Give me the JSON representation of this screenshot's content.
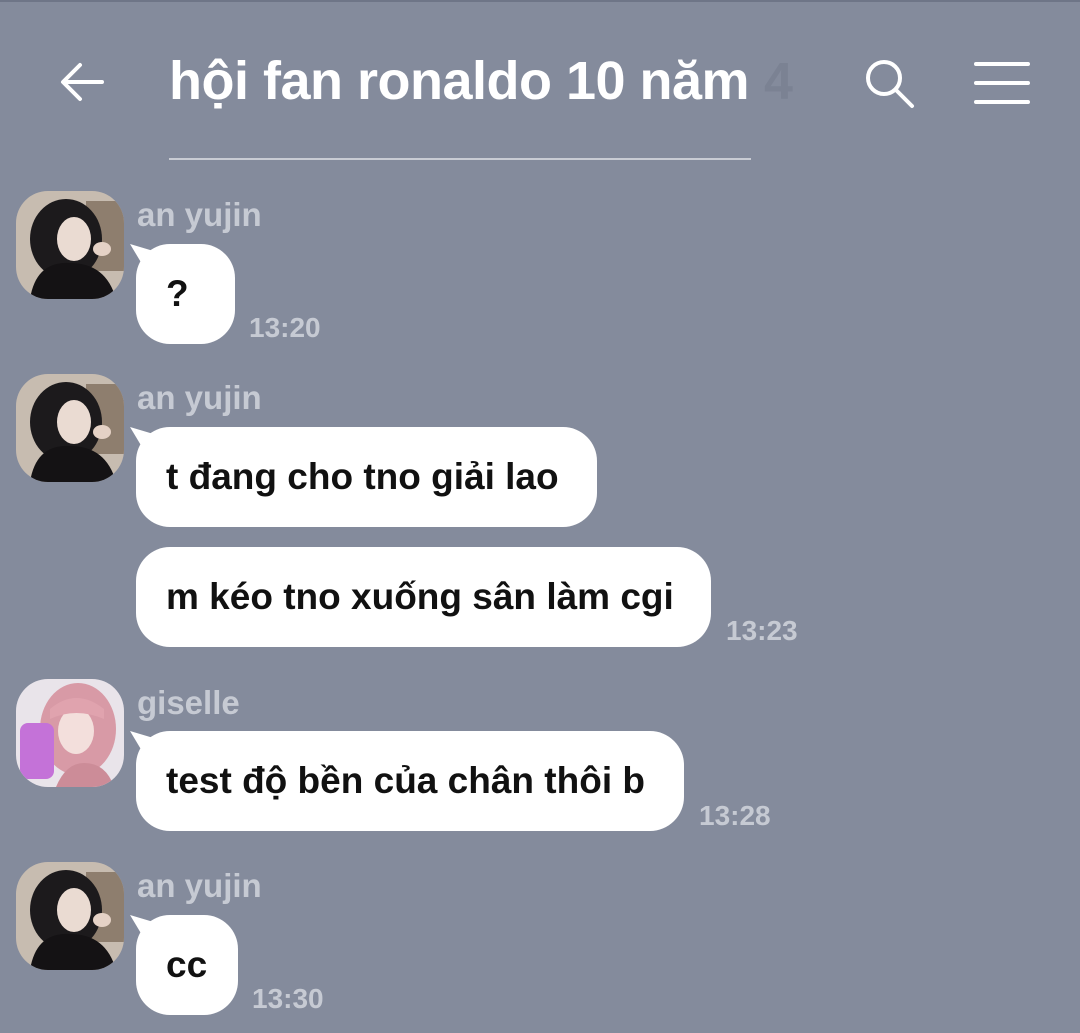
{
  "header": {
    "title": "hội fan ronaldo 10 năm",
    "member_count": "4",
    "back_icon": "arrow-left-icon",
    "search_icon": "search-icon",
    "menu_icon": "menu-icon"
  },
  "colors": {
    "background": "#848b9c",
    "bubble": "#ffffff",
    "meta_text": "#c6cad3"
  },
  "messages": [
    {
      "sender": "an yujin",
      "text": "?",
      "time": "13:20"
    },
    {
      "sender": "an yujin",
      "text": "t đang cho tno giải lao",
      "time": ""
    },
    {
      "sender": "",
      "text": "m kéo tno xuống sân làm cgi",
      "time": "13:23"
    },
    {
      "sender": "giselle",
      "text": "test độ bền của chân thôi b",
      "time": "13:28"
    },
    {
      "sender": "an yujin",
      "text": "cc",
      "time": "13:30"
    }
  ]
}
